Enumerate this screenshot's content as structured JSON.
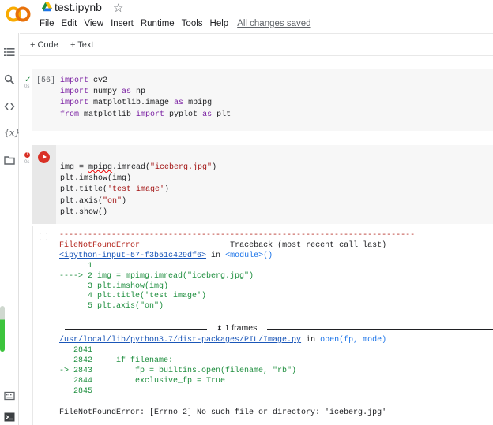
{
  "header": {
    "logo": "CO",
    "title": "test.ipynb",
    "menu": [
      "File",
      "Edit",
      "View",
      "Insert",
      "Runtime",
      "Tools",
      "Help"
    ],
    "saved_status": "All changes saved"
  },
  "toolbar": {
    "code_label": "+ Code",
    "text_label": "+ Text"
  },
  "sidebar": {
    "variables_label": "{x}"
  },
  "cells": [
    {
      "exec_count": "[56]",
      "exec_time": "0s",
      "lines": [
        "import cv2",
        "import numpy as np",
        "import matplotlib.image as mpimg",
        "from matplotlib import pyplot as plt"
      ]
    },
    {
      "exec_time": "0s",
      "error_badge": "1",
      "lines": [
        "img = mpimg.imread(\"iceberg.jpg\")",
        "plt.imshow(img)",
        "plt.title('test image')",
        "plt.axis(\"on\")",
        "plt.show()"
      ]
    }
  ],
  "output": {
    "dashes": "---------------------------------------------------------------------------",
    "error_name": "FileNotFoundError",
    "traceback_label": "Traceback (most recent call last)",
    "input_link": "<ipython-input-57-f3b51c429df6>",
    "in_word": "in",
    "module": "<module>()",
    "frame1": [
      "      1",
      "----> 2 img = mpimg.imread(\"iceberg.jpg\")",
      "      3 plt.imshow(img)",
      "      4 plt.title('test image')",
      "      5 plt.axis(\"on\")"
    ],
    "frames_label": "1 frames",
    "lib_path": "/usr/local/lib/python3.7/dist-packages/PIL/Image.py",
    "lib_in": "in",
    "lib_func": "open(fp, mode)",
    "frame2": [
      "   2841",
      "   2842     if filename:",
      "-> 2843         fp = builtins.open(filename, \"rb\")",
      "   2844         exclusive_fp = True",
      "   2845"
    ],
    "final_error": "FileNotFoundError: [Errno 2] No such file or directory: 'iceberg.jpg'"
  }
}
